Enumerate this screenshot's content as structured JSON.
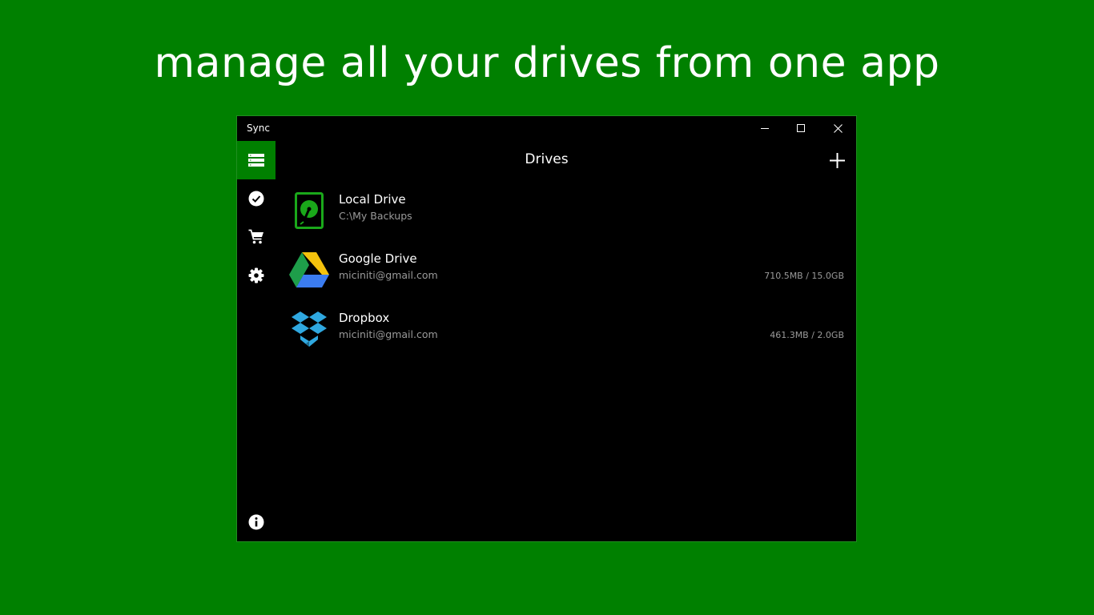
{
  "headline": "manage all your drives from one app",
  "window": {
    "title": "Sync",
    "controls": {
      "minimize_icon": "minimize-icon",
      "maximize_icon": "maximize-icon",
      "close_icon": "close-icon"
    }
  },
  "sidebar": {
    "items": [
      {
        "id": "drives",
        "icon": "server-list-icon",
        "active": true
      },
      {
        "id": "tasks",
        "icon": "check-circle-icon",
        "active": false
      },
      {
        "id": "store",
        "icon": "shopping-cart-icon",
        "active": false
      },
      {
        "id": "settings",
        "icon": "gear-icon",
        "active": false
      }
    ],
    "bottom": {
      "id": "about",
      "icon": "info-icon"
    }
  },
  "header": {
    "title": "Drives",
    "add_icon": "plus-icon"
  },
  "drives": [
    {
      "name": "Local Drive",
      "subtitle": "C:\\My Backups",
      "usage": "",
      "icon": "hard-drive-icon"
    },
    {
      "name": "Google Drive",
      "subtitle": "miciniti@gmail.com",
      "usage": "710.5MB / 15.0GB",
      "icon": "google-drive-icon"
    },
    {
      "name": "Dropbox",
      "subtitle": "miciniti@gmail.com",
      "usage": "461.3MB / 2.0GB",
      "icon": "dropbox-icon"
    }
  ],
  "colors": {
    "background": "#008000",
    "window": "#000000",
    "accent": "#008000",
    "text": "#ffffff",
    "subtext": "#9a9a9a"
  }
}
